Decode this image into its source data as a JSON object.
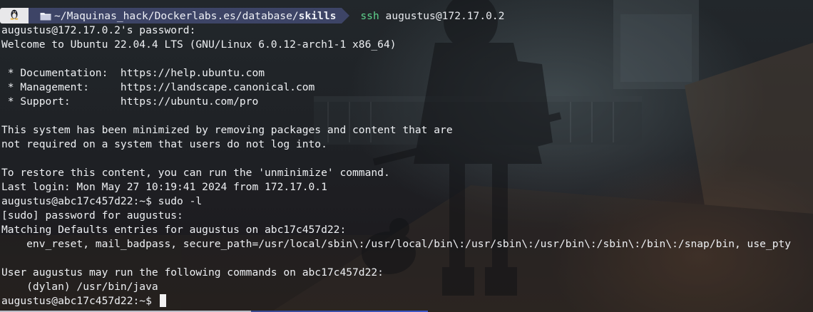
{
  "prompt": {
    "os_icon": "linux-tux-icon",
    "folder_icon": "folder-icon",
    "path_prefix": "~/Maquinas_hack/Dockerlabs.es/database/",
    "path_current": "skills",
    "command_name": "ssh",
    "command_args": "augustus@172.17.0.2"
  },
  "terminal": {
    "lines": [
      "augustus@172.17.0.2's password:",
      "Welcome to Ubuntu 22.04.4 LTS (GNU/Linux 6.0.12-arch1-1 x86_64)",
      "",
      " * Documentation:  https://help.ubuntu.com",
      " * Management:     https://landscape.canonical.com",
      " * Support:        https://ubuntu.com/pro",
      "",
      "This system has been minimized by removing packages and content that are",
      "not required on a system that users do not log into.",
      "",
      "To restore this content, you can run the 'unminimize' command.",
      "Last login: Mon May 27 10:19:41 2024 from 172.17.0.1",
      "augustus@abc17c457d22:~$ sudo -l",
      "[sudo] password for augustus:",
      "Matching Defaults entries for augustus on abc17c457d22:",
      "    env_reset, mail_badpass, secure_path=/usr/local/sbin\\:/usr/local/bin\\:/usr/sbin\\:/usr/bin\\:/sbin\\:/bin\\:/snap/bin, use_pty",
      "",
      "User augustus may run the following commands on abc17c457d22:",
      "    (dylan) /usr/bin/java"
    ],
    "current_prompt": "augustus@abc17c457d22:~$ "
  },
  "colors": {
    "background": "#1c1d24",
    "text": "#eef0f3",
    "os_segment": "#e8e8ea",
    "path_segment": "#3d4466",
    "ssh_command": "#5fd38d",
    "cursor": "#f2f2f2"
  }
}
